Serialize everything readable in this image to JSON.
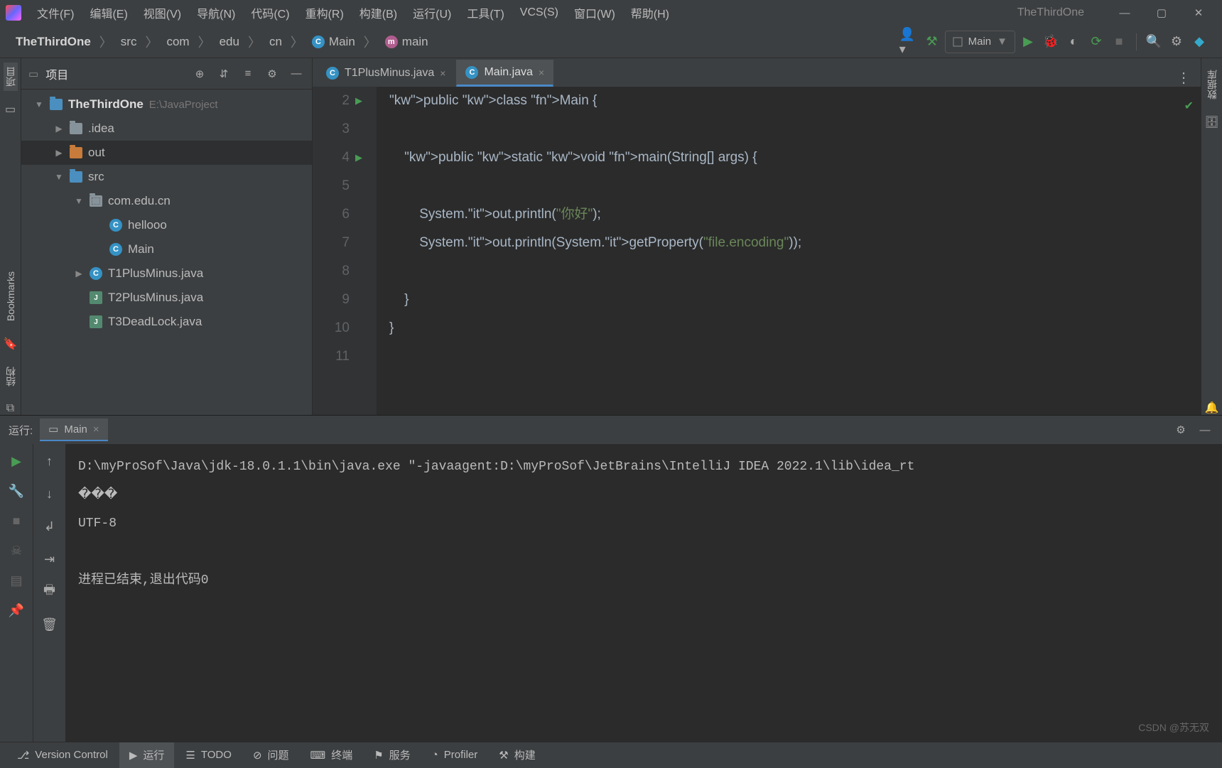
{
  "app": {
    "title": "TheThirdOne"
  },
  "menu": {
    "items": [
      "文件(F)",
      "编辑(E)",
      "视图(V)",
      "导航(N)",
      "代码(C)",
      "重构(R)",
      "构建(B)",
      "运行(U)",
      "工具(T)",
      "VCS(S)",
      "窗口(W)",
      "帮助(H)"
    ]
  },
  "breadcrumb": {
    "project": "TheThirdOne",
    "parts": [
      "src",
      "com",
      "edu",
      "cn"
    ],
    "class": "Main",
    "method": "main"
  },
  "toolbar": {
    "runconfig": "Main"
  },
  "project": {
    "title": "项目",
    "root": "TheThirdOne",
    "root_path": "E:\\JavaProject",
    "items": [
      {
        "indent": 1,
        "tw": "▶",
        "ic": "folder",
        "label": ".idea"
      },
      {
        "indent": 1,
        "tw": "▶",
        "ic": "folder-orange",
        "label": "out",
        "sel": true
      },
      {
        "indent": 1,
        "tw": "▼",
        "ic": "folder-blue",
        "label": "src"
      },
      {
        "indent": 2,
        "tw": "▼",
        "ic": "folder-pkg",
        "label": "com.edu.cn"
      },
      {
        "indent": 3,
        "tw": "",
        "ic": "class",
        "label": "hellooo"
      },
      {
        "indent": 3,
        "tw": "",
        "ic": "class",
        "label": "Main"
      },
      {
        "indent": 2,
        "tw": "▶",
        "ic": "class",
        "label": "T1PlusMinus.java"
      },
      {
        "indent": 2,
        "tw": "",
        "ic": "java",
        "label": "T2PlusMinus.java"
      },
      {
        "indent": 2,
        "tw": "",
        "ic": "java",
        "label": "T3DeadLock.java"
      }
    ]
  },
  "editor": {
    "tabs": [
      {
        "label": "T1PlusMinus.java"
      },
      {
        "label": "Main.java",
        "active": true
      }
    ],
    "lines_from": 2,
    "lines_to": 11,
    "code": [
      "public class Main {",
      "",
      "    public static void main(String[] args) {",
      "",
      "        System.out.println(\"你好\");",
      "        System.out.println(System.getProperty(\"file.encoding\"));",
      "",
      "    }",
      "}",
      ""
    ]
  },
  "run": {
    "title": "运行:",
    "tab": "Main",
    "output": [
      "D:\\myProSof\\Java\\jdk-18.0.1.1\\bin\\java.exe \"-javaagent:D:\\myProSof\\JetBrains\\IntelliJ IDEA 2022.1\\lib\\idea_rt",
      "���",
      "UTF-8",
      "",
      "进程已结束,退出代码0"
    ]
  },
  "bottom": {
    "tabs": [
      "Version Control",
      "运行",
      "TODO",
      "问题",
      "终端",
      "服务",
      "Profiler",
      "构建"
    ]
  },
  "left_tabs": {
    "project": "项目",
    "bookmarks": "Bookmarks",
    "structure": "结构"
  },
  "right_tabs": {
    "db": "数据库",
    "notif": "通知"
  },
  "watermark": "CSDN @苏无双"
}
